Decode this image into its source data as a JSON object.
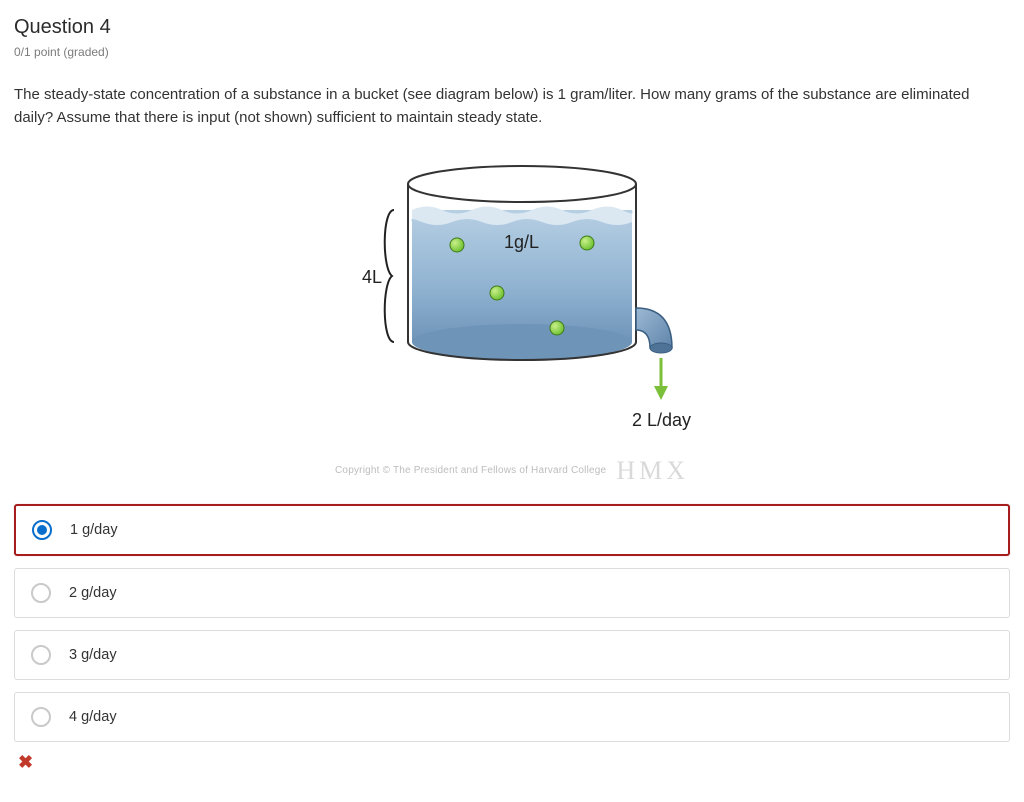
{
  "question": {
    "title": "Question 4",
    "points": "0/1 point (graded)",
    "prompt": "The steady-state concentration of a substance in a bucket (see diagram below) is 1 gram/liter. How many grams of the substance are eliminated daily? Assume that there is input (not shown) sufficient to maintain steady state."
  },
  "diagram": {
    "volume_label": "4L",
    "concentration_label": "1g/L",
    "outflow_label": "2 L/day"
  },
  "copyright": {
    "text": "Copyright © The President and Fellows of Harvard College",
    "brand": "HMX"
  },
  "choices": [
    {
      "label": "1 g/day",
      "selected": true
    },
    {
      "label": "2 g/day",
      "selected": false
    },
    {
      "label": "3 g/day",
      "selected": false
    },
    {
      "label": "4 g/day",
      "selected": false
    }
  ],
  "feedback_icon": "✖"
}
